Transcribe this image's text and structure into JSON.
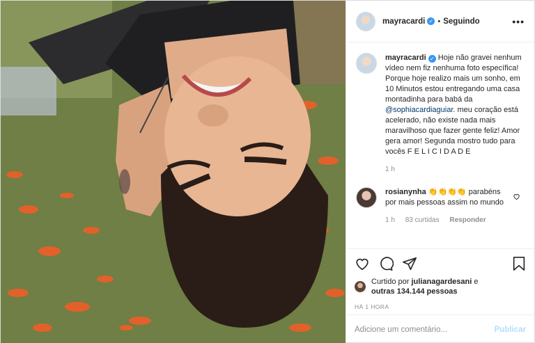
{
  "header": {
    "username": "mayracardi",
    "verified_icon": "verified-badge-icon",
    "separator": "•",
    "follow_status": "Seguindo",
    "more_label": "•••"
  },
  "caption": {
    "username": "mayracardi",
    "text_before_mention": "Hoje não gravei nenhum vídeo nem fiz nenhuma foto específica! Porque hoje realizo mais um sonho, em 10 Minutos estou entregando uma casa montadinha para babá da ",
    "mention": "@sophiacardiaguiar",
    "text_after_mention": ". meu coração está acelerado, não existe nada mais maravilhoso que fazer gente feliz! Amor gera amor! Segunda mostro tudo para vocês F E L I C I D A D E",
    "time": "1 h"
  },
  "comment": {
    "username": "rosianynha",
    "emojis": "👏👏👏👏",
    "text": "parabéns por mais pessoas assim no mundo",
    "time": "1 h",
    "likes": "83 curtidas",
    "reply_label": "Responder"
  },
  "likes": {
    "prefix": "Curtido por",
    "user": "julianagardesani",
    "middle": "e",
    "others": "outras 134.144 pessoas"
  },
  "timestamp": "HÁ 1 HORA",
  "add_comment": {
    "placeholder": "Adicione um comentário...",
    "publish_label": "Publicar"
  },
  "colors": {
    "verified": "#3897f0",
    "mention": "#00376b",
    "publish_disabled": "#b2dffc",
    "muted": "#8e8e8e"
  }
}
